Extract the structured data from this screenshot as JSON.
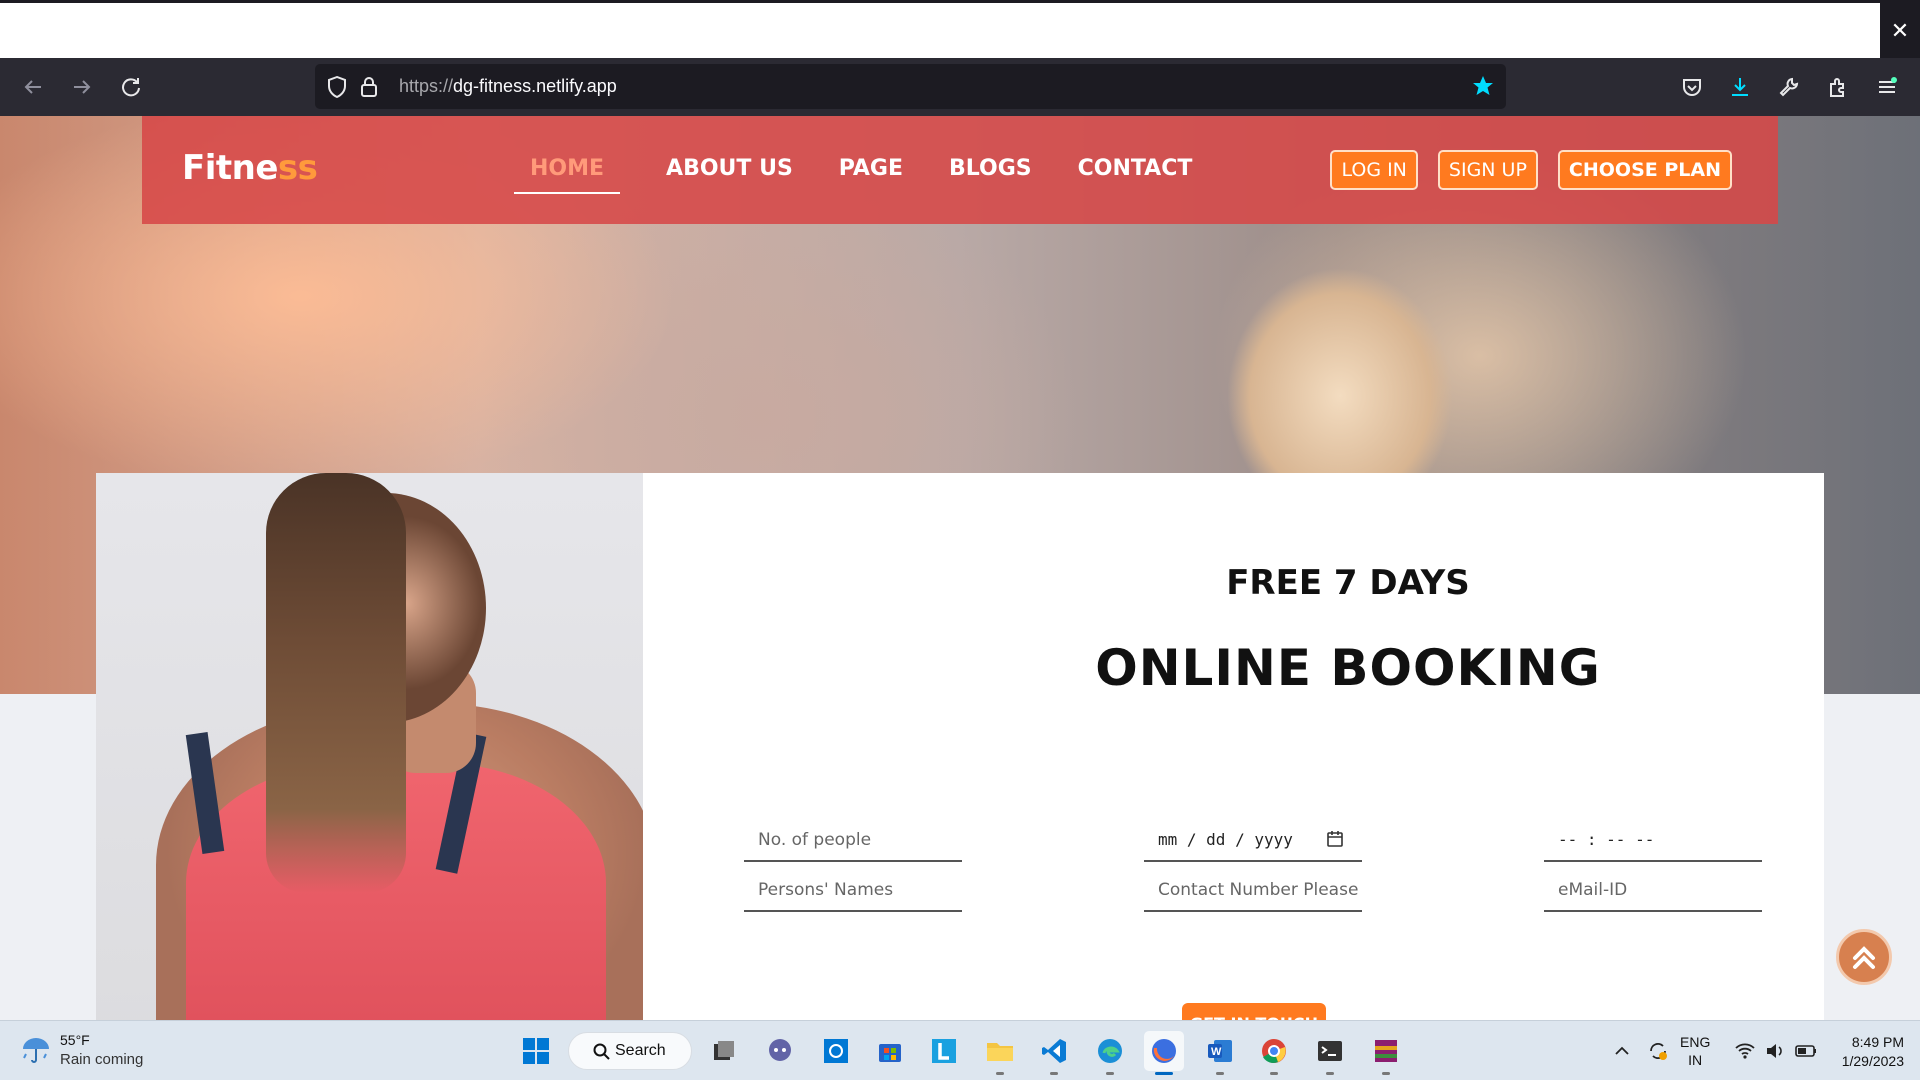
{
  "browser": {
    "url_scheme": "https://",
    "url_host": "dg-fitness.netlify.app",
    "close_symbol": "✕"
  },
  "site": {
    "logo_main": "Fitne",
    "logo_accent": "ss",
    "menu": [
      {
        "label": "HOME",
        "active": true
      },
      {
        "label": "ABOUT US",
        "active": false
      },
      {
        "label": "PAGE",
        "active": false
      },
      {
        "label": "BLOGS",
        "active": false
      },
      {
        "label": "CONTACT",
        "active": false
      }
    ],
    "buttons": {
      "login": "LOG IN",
      "signup": "SIGN UP",
      "choose_plan": "CHOOSE PLAN"
    }
  },
  "booking": {
    "heading_small": "FREE 7 DAYS",
    "heading_large": "ONLINE BOOKING",
    "fields": {
      "people_placeholder": "No. of people",
      "date_placeholder": "mm / dd / yyyy",
      "time_placeholder": "-- : --   --",
      "names_placeholder": "Persons' Names",
      "contact_placeholder": "Contact Number Please",
      "email_placeholder": "eMail-ID"
    },
    "submit_label": "GET IN TOUCH"
  },
  "taskbar": {
    "weather_temp": "55°F",
    "weather_desc": "Rain coming",
    "search_label": "Search",
    "lang_1": "ENG",
    "lang_2": "IN",
    "time": "8:49 PM",
    "date": "1/29/2023"
  },
  "colors": {
    "nav_bg": "#d64848",
    "accent_orange": "#ff7a1f",
    "browser_dark": "#2b2a33",
    "star_cyan": "#00ddff"
  }
}
